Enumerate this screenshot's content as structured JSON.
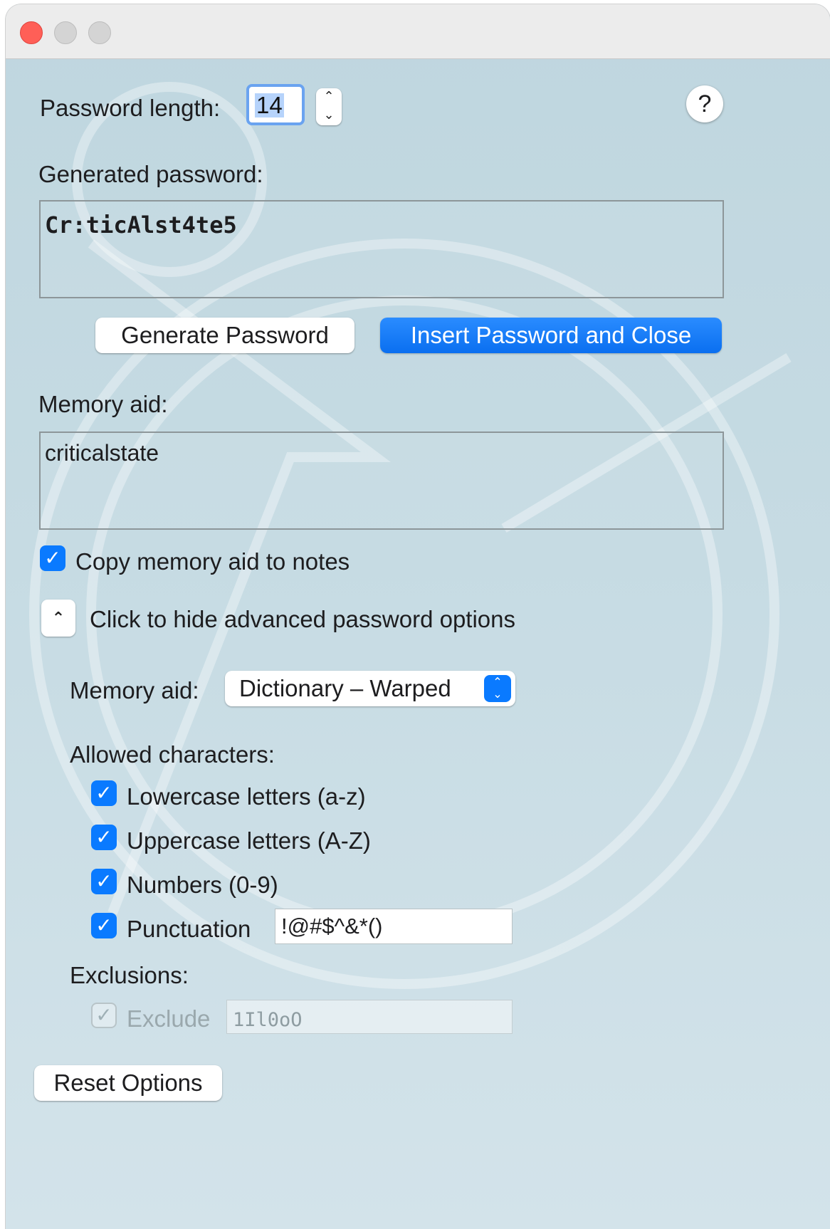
{
  "window": {
    "title": ""
  },
  "length": {
    "label": "Password length:",
    "value": "14",
    "stepper_up": "⌃",
    "stepper_down": "⌄"
  },
  "help": {
    "label": "?"
  },
  "generated": {
    "label": "Generated password:",
    "value": "Cr:ticAlst4te5"
  },
  "buttons": {
    "generate": "Generate Password",
    "insert_close": "Insert Password and Close",
    "reset": "Reset Options"
  },
  "memory": {
    "label": "Memory aid:",
    "value": "criticalstate",
    "copy_label": "Copy memory aid to notes",
    "copy_checked": true
  },
  "advanced": {
    "toggle_label": "Click to hide advanced password options",
    "memory_aid_label": "Memory aid:",
    "memory_aid_value": "Dictionary – Warped",
    "allowed_label": "Allowed characters:",
    "options": [
      {
        "label": "Lowercase letters (a-z)",
        "checked": true
      },
      {
        "label": "Uppercase letters (A-Z)",
        "checked": true
      },
      {
        "label": "Numbers (0-9)",
        "checked": true
      },
      {
        "label": "Punctuation",
        "checked": true
      }
    ],
    "punctuation_value": "!@#$^&*()",
    "exclusions_label": "Exclusions:",
    "exclude_label": "Exclude",
    "exclude_checked": true,
    "exclude_enabled": false,
    "exclude_value": "1Il0oO"
  },
  "icons": {
    "check": "✓",
    "chevron_up": "⌃"
  },
  "colors": {
    "accent": "#0a7aff",
    "window_background": "#c4dae2",
    "close_light": "#ff5f57"
  }
}
